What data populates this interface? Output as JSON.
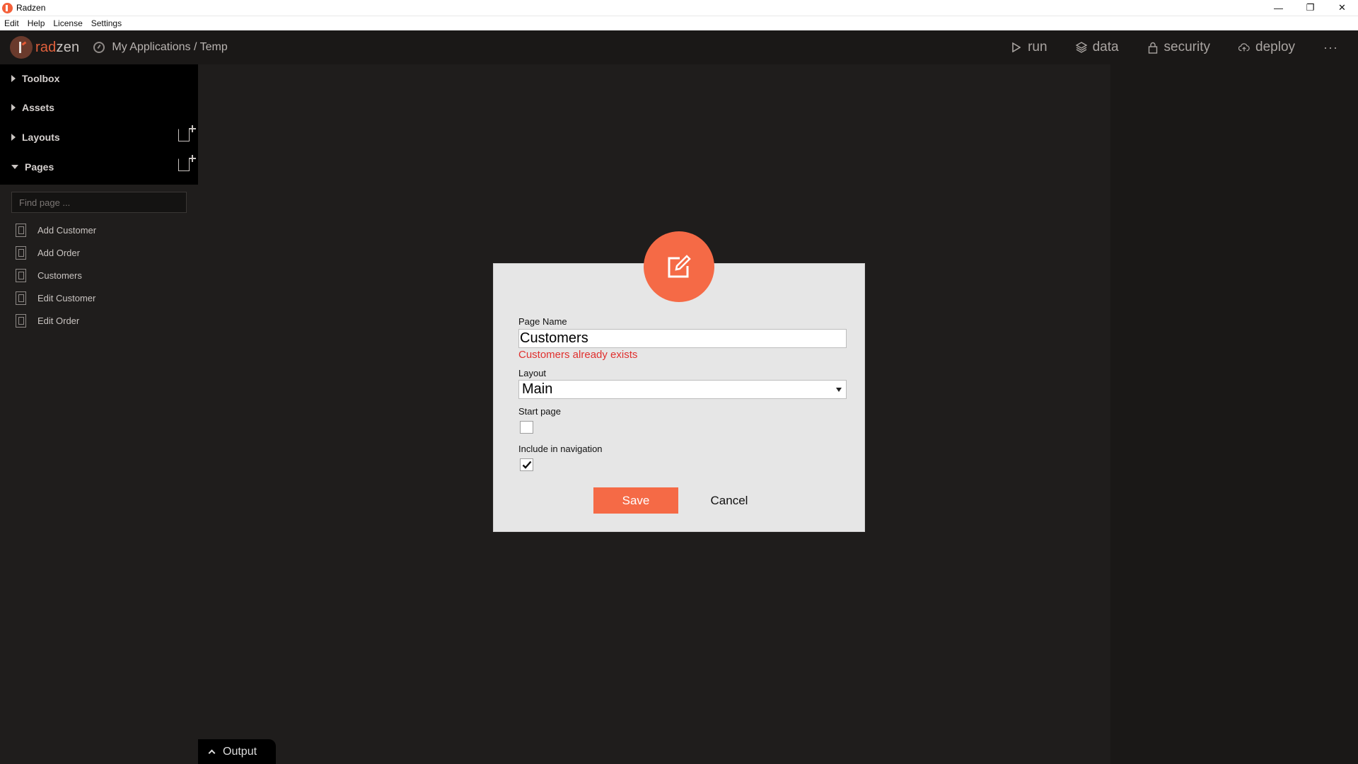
{
  "window": {
    "title": "Radzen",
    "controls": {
      "minimize": "—",
      "restore": "❐",
      "close": "✕"
    }
  },
  "menu": [
    "Edit",
    "Help",
    "License",
    "Settings"
  ],
  "header": {
    "logo_part1": "rad",
    "logo_part2": "zen",
    "breadcrumb": "My Applications / Temp",
    "nav": [
      {
        "label": "run",
        "icon": "play-icon"
      },
      {
        "label": "data",
        "icon": "layers-icon"
      },
      {
        "label": "security",
        "icon": "lock-icon"
      },
      {
        "label": "deploy",
        "icon": "cloud-upload-icon"
      }
    ],
    "more": "···"
  },
  "sidebar": {
    "sections": [
      "Toolbox",
      "Assets",
      "Layouts",
      "Pages"
    ],
    "find_placeholder": "Find page ...",
    "pages": [
      "Add Customer",
      "Add Order",
      "Customers",
      "Edit Customer",
      "Edit Order"
    ]
  },
  "output_tab": "Output",
  "dialog": {
    "page_name_label": "Page Name",
    "page_name_value": "Customers",
    "error": "Customers already exists",
    "layout_label": "Layout",
    "layout_value": "Main",
    "start_page_label": "Start page",
    "start_page_checked": false,
    "include_nav_label": "Include in navigation",
    "include_nav_checked": true,
    "save": "Save",
    "cancel": "Cancel"
  },
  "colors": {
    "accent": "#f56a46",
    "error": "#e0302e",
    "background": "#1f1d1c"
  }
}
